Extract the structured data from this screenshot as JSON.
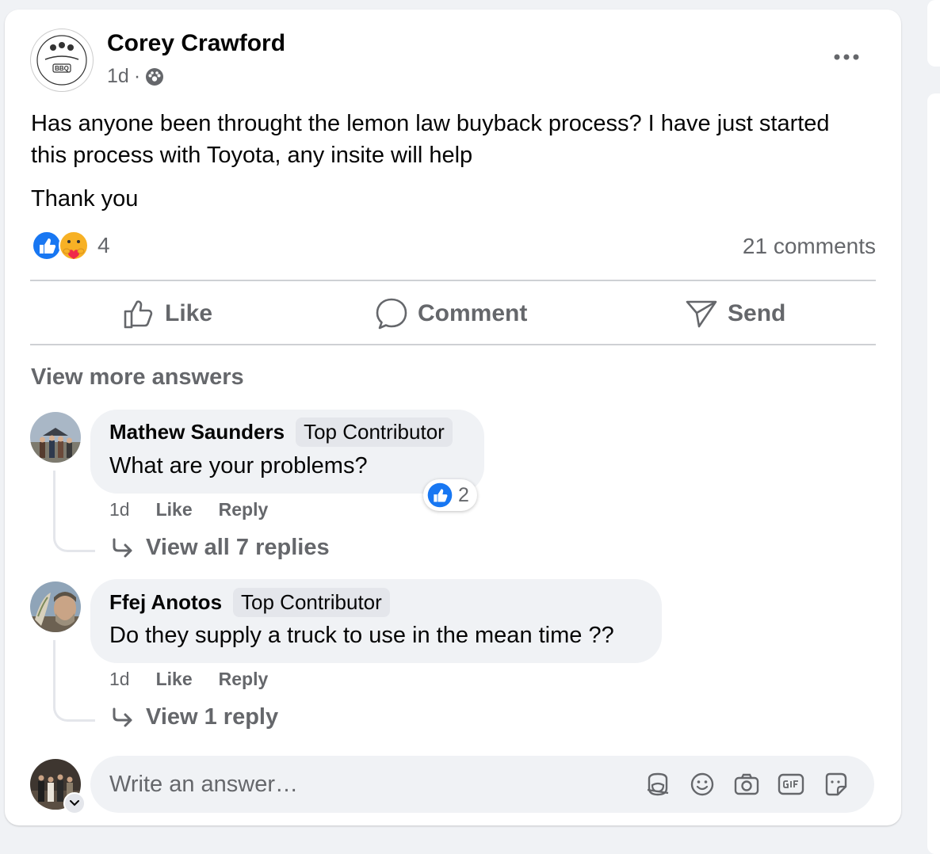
{
  "post": {
    "author": "Corey Crawford",
    "logo_text": "BBQ",
    "time": "1d",
    "separator": "·",
    "text_line1": "Has anyone been throught the lemon law buyback process?   I have just started this process with Toyota, any insite will help",
    "text_line2": "Thank you",
    "reactions_count": "4",
    "comments_count": "21 comments",
    "reaction_icons": [
      "like-reaction-icon",
      "care-reaction-icon"
    ]
  },
  "actions": {
    "like": "Like",
    "comment": "Comment",
    "send": "Send"
  },
  "view_more": "View more answers",
  "comments": [
    {
      "name": "Mathew Saunders",
      "badge": "Top Contributor",
      "text": "What are your problems?",
      "time": "1d",
      "like": "Like",
      "reply": "Reply",
      "likes": "2",
      "view_replies": "View all 7 replies"
    },
    {
      "name": "Ffej Anotos",
      "badge": "Top Contributor",
      "text": "Do they supply a truck to use in the mean time ??",
      "time": "1d",
      "like": "Like",
      "reply": "Reply",
      "view_replies": "View 1 reply"
    }
  ],
  "composer": {
    "placeholder": "Write an answer…",
    "tools": [
      "avatar-sticker-icon",
      "emoji-icon",
      "camera-icon",
      "gif-icon",
      "sticker-icon"
    ]
  },
  "colors": {
    "like_blue": "#1877f2",
    "secondary_text": "#65676b",
    "bubble_bg": "#f0f2f5"
  }
}
